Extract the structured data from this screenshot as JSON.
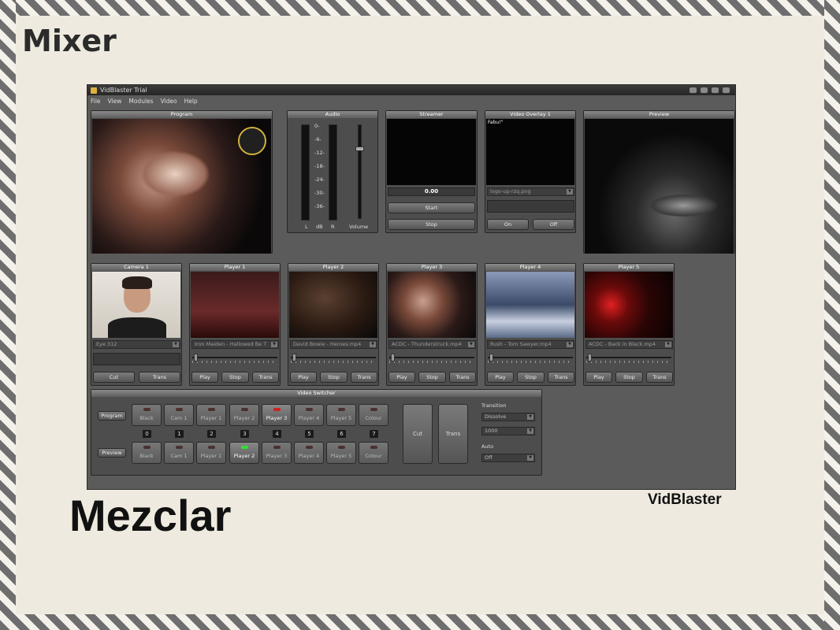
{
  "slide": {
    "title": "Mixer",
    "subtitle": "Mezclar",
    "brand": "VidBlaster"
  },
  "app": {
    "title": "VidBlaster Trial",
    "menu": [
      "File",
      "View",
      "Modules",
      "Video",
      "Help"
    ],
    "program": {
      "title": "Program"
    },
    "audio": {
      "title": "Audio",
      "scale": [
        "0-",
        "-6-",
        "-12-",
        "-18-",
        "-24-",
        "-30-",
        "-36-"
      ],
      "labels": {
        "l": "L",
        "db": "dB",
        "r": "R",
        "volume": "Volume"
      }
    },
    "streamer": {
      "title": "Streamer",
      "value": "0.00",
      "start": "Start",
      "stop": "Stop"
    },
    "overlay": {
      "title": "Video Overlay 1",
      "screen_text": "Fabu!\"",
      "file": "logo-up-rzq.png",
      "on": "On",
      "off": "Off"
    },
    "preview": {
      "title": "Preview"
    },
    "camera": {
      "title": "Camera 1",
      "device": "Eye 312",
      "cut": "Cut",
      "trans": "Trans"
    },
    "players": [
      {
        "title": "Player 1",
        "file": "Iron Maiden - Hallowed Be T",
        "led": "off",
        "play": "Play",
        "stop": "Stop",
        "trans": "Trans"
      },
      {
        "title": "Player 2",
        "file": "David Bowie - Heroes.mp4",
        "led": "green",
        "play": "Play",
        "stop": "Stop",
        "trans": "Trans"
      },
      {
        "title": "Player 3",
        "file": "ACDC - Thunderstruck.mp4",
        "led": "red",
        "play": "Play",
        "stop": "Stop",
        "trans": "Trans"
      },
      {
        "title": "Player 4",
        "file": "Rush - Tom Sawyer.mp4",
        "led": "off",
        "play": "Play",
        "stop": "Stop",
        "trans": "Trans"
      },
      {
        "title": "Player 5",
        "file": "ACDC - Back in Black.mp4",
        "led": "off",
        "play": "Play",
        "stop": "Stop",
        "trans": "Trans"
      }
    ],
    "switcher": {
      "title": "Video Switcher",
      "program_label": "Program",
      "preview_label": "Preview",
      "program_buttons": [
        "Black",
        "Cam 1",
        "Player 1",
        "Player 2",
        "Player 3",
        "Player 4",
        "Player 5",
        "Colour"
      ],
      "program_active": "Player 3",
      "preview_buttons": [
        "Black",
        "Cam 1",
        "Player 1",
        "Player 2",
        "Player 3",
        "Player 4",
        "Player 5",
        "Colour"
      ],
      "preview_active": "Player 2",
      "numbers": [
        "0",
        "1",
        "2",
        "3",
        "4",
        "5",
        "6",
        "7"
      ],
      "cut": "Cut",
      "trans": "Trans",
      "transition_label": "Transition",
      "transition_value": "Dissolve",
      "duration_value": "1000",
      "auto_label": "Auto",
      "auto_value": "Off"
    }
  },
  "colors": {
    "led_green": "#28c028",
    "led_red": "#d02020",
    "panel": "#4d4d4d",
    "app_bg": "#5b5b5b"
  }
}
